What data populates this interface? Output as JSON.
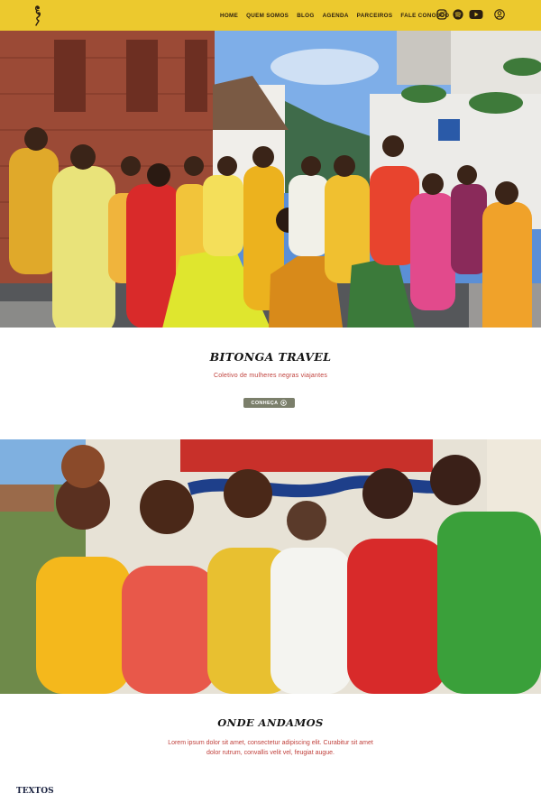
{
  "header": {
    "logo_icon": "woman-silhouette-logo",
    "nav": [
      {
        "label": "HOME"
      },
      {
        "label": "QUEM SOMOS"
      },
      {
        "label": "BLOG"
      },
      {
        "label": "AGENDA"
      },
      {
        "label": "PARCEIROS"
      },
      {
        "label": "FALE CONOSCO"
      }
    ],
    "social_icons": [
      "instagram-icon",
      "spotify-icon",
      "youtube-icon"
    ],
    "account_icon": "user-icon"
  },
  "hero": {
    "title": "BITONGA TRAVEL",
    "subtitle": "Coletivo de mulheres negras viajantes",
    "cta_label": "CONHEÇA",
    "cta_icon": "plus-circle-icon"
  },
  "section": {
    "title": "ONDE ANDAMOS",
    "body": "Lorem ipsum dolor sit amet, consectetur adipiscing elit. Curabitur sit amet dolor rutrum, convallis velit vel, feugiat augue."
  },
  "texts": {
    "heading": "TEXTOS"
  },
  "colors": {
    "header_bg": "#ecc92e",
    "accent_red": "#c0413c",
    "button_bg": "#7b7f6b",
    "heading_navy": "#1a2240"
  }
}
